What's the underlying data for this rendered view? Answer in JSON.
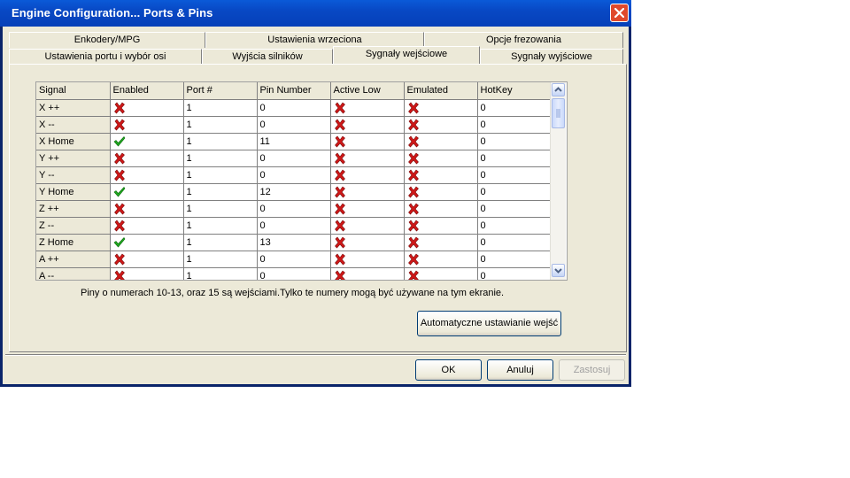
{
  "window": {
    "title": "Engine Configuration... Ports & Pins"
  },
  "tabs_row1": [
    "Enkodery/MPG",
    "Ustawienia wrzeciona",
    "Opcje frezowania"
  ],
  "tabs_row2": [
    "Ustawienia portu i wybór osi",
    "Wyjścia silników",
    "Sygnały wejściowe",
    "Sygnały wyjściowe"
  ],
  "active_tab": "Sygnały wejściowe",
  "table": {
    "columns": [
      "Signal",
      "Enabled",
      "Port #",
      "Pin Number",
      "Active Low",
      "Emulated",
      "HotKey"
    ],
    "rows": [
      {
        "signal": "X ++",
        "enabled": "cross",
        "port": "1",
        "pin": "0",
        "active_low": "cross",
        "emulated": "cross",
        "hotkey": "0"
      },
      {
        "signal": "X --",
        "enabled": "cross",
        "port": "1",
        "pin": "0",
        "active_low": "cross",
        "emulated": "cross",
        "hotkey": "0"
      },
      {
        "signal": "X Home",
        "enabled": "check",
        "port": "1",
        "pin": "11",
        "active_low": "cross",
        "emulated": "cross",
        "hotkey": "0"
      },
      {
        "signal": "Y ++",
        "enabled": "cross",
        "port": "1",
        "pin": "0",
        "active_low": "cross",
        "emulated": "cross",
        "hotkey": "0"
      },
      {
        "signal": "Y --",
        "enabled": "cross",
        "port": "1",
        "pin": "0",
        "active_low": "cross",
        "emulated": "cross",
        "hotkey": "0"
      },
      {
        "signal": "Y Home",
        "enabled": "check",
        "port": "1",
        "pin": "12",
        "active_low": "cross",
        "emulated": "cross",
        "hotkey": "0"
      },
      {
        "signal": "Z ++",
        "enabled": "cross",
        "port": "1",
        "pin": "0",
        "active_low": "cross",
        "emulated": "cross",
        "hotkey": "0"
      },
      {
        "signal": "Z --",
        "enabled": "cross",
        "port": "1",
        "pin": "0",
        "active_low": "cross",
        "emulated": "cross",
        "hotkey": "0"
      },
      {
        "signal": "Z Home",
        "enabled": "check",
        "port": "1",
        "pin": "13",
        "active_low": "cross",
        "emulated": "cross",
        "hotkey": "0"
      },
      {
        "signal": "A ++",
        "enabled": "cross",
        "port": "1",
        "pin": "0",
        "active_low": "cross",
        "emulated": "cross",
        "hotkey": "0"
      },
      {
        "signal": "A --",
        "enabled": "cross",
        "port": "1",
        "pin": "0",
        "active_low": "cross",
        "emulated": "cross",
        "hotkey": "0"
      }
    ]
  },
  "info_text": "Piny o numerach 10-13, oraz 15 są wejściami.Tylko te numery mogą być używane na tym ekranie.",
  "buttons": {
    "auto": "Automatyczne ustawianie wejść",
    "ok": "OK",
    "cancel": "Anuluj",
    "apply": "Zastosuj"
  },
  "icons": {
    "cross": "red-x-icon",
    "check": "green-check-icon",
    "close": "close-icon"
  },
  "colors": {
    "titlebar": "#0848c4",
    "close": "#e0492c",
    "cross": "#d01818",
    "check": "#22aa22"
  }
}
